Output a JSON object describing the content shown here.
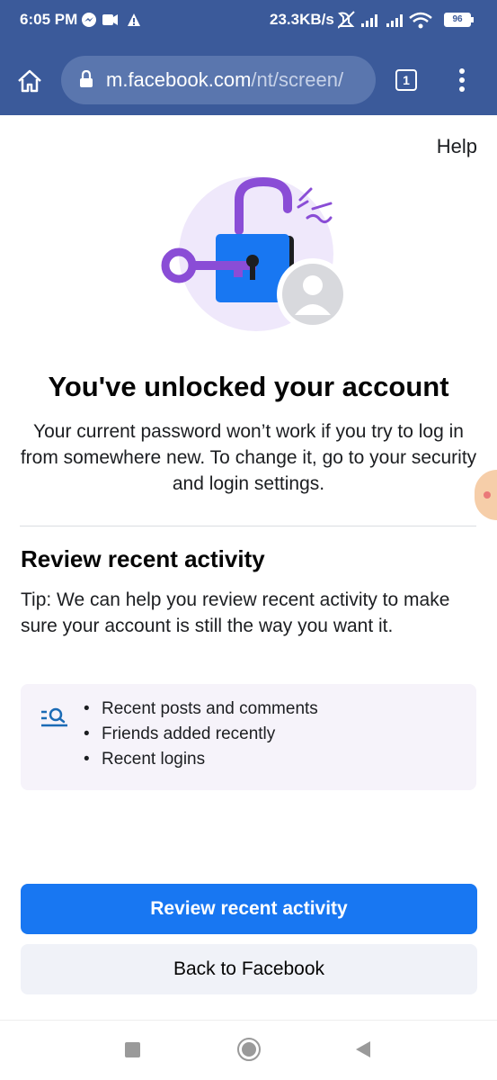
{
  "status_bar": {
    "time": "6:05 PM",
    "network_speed": "23.3KB/s",
    "battery": "96"
  },
  "browser": {
    "url_host": "m.facebook.com",
    "url_path": "/nt/screen/",
    "tab_count": "1"
  },
  "page": {
    "help_label": "Help",
    "title": "You've unlocked your account",
    "description": "Your current password won’t work if you try to log in from somewhere new. To change it, go to your security and login settings.",
    "section_title": "Review recent activity",
    "tip": "Tip: We can help you review recent activity to make sure your account is still the way you want it.",
    "activity_items": [
      "Recent posts and comments",
      "Friends added recently",
      "Recent logins"
    ],
    "primary_button": "Review recent activity",
    "secondary_button": "Back to Facebook"
  },
  "colors": {
    "browser_bar": "#3b5a9a",
    "primary": "#1877f2",
    "lock_shackle": "#8a4dd6",
    "activity_box": "#f6f3fa"
  }
}
